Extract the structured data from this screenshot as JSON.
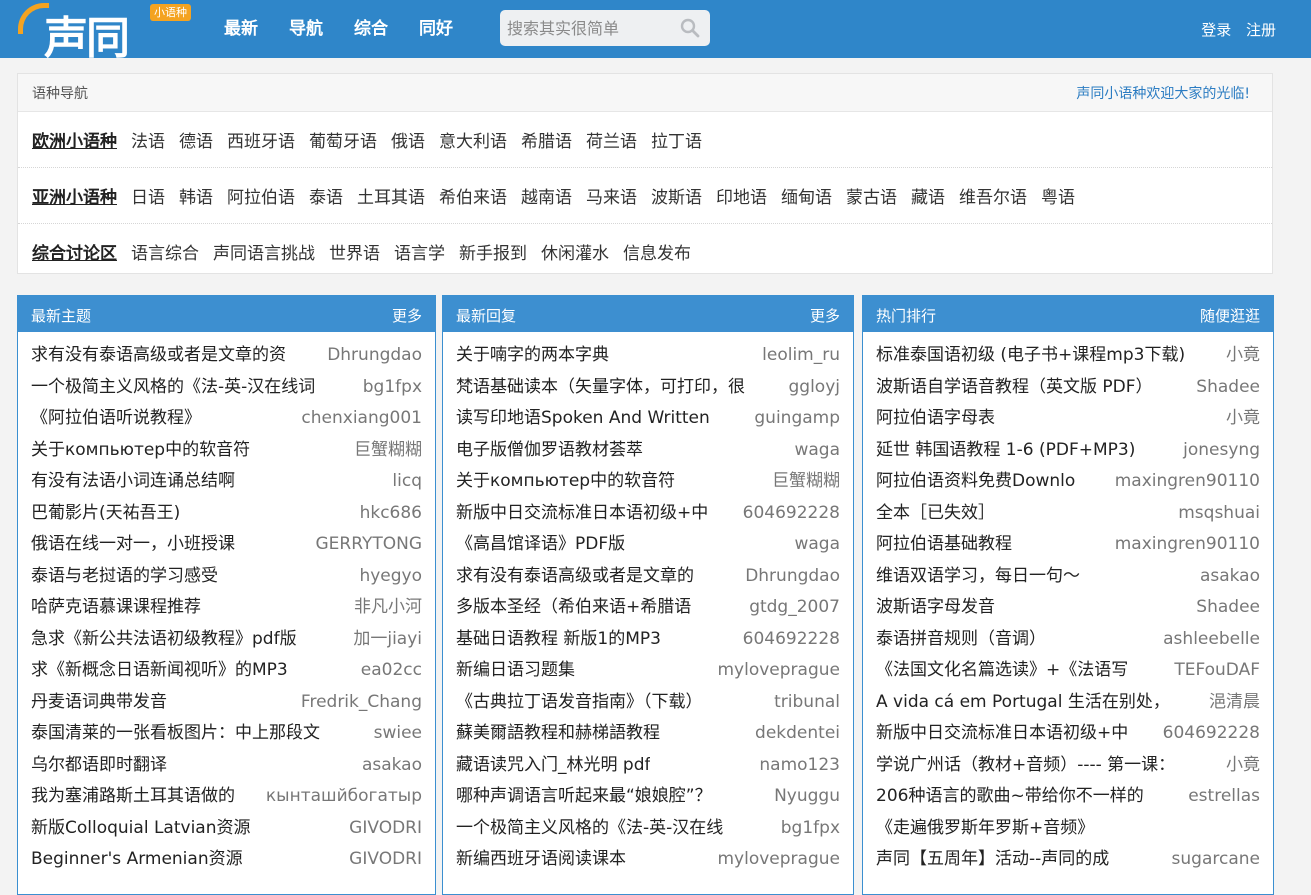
{
  "header": {
    "logo_text": "声同",
    "logo_badge": "小语种",
    "nav": [
      "最新",
      "导航",
      "综合",
      "同好"
    ],
    "search_placeholder": "搜索其实很简单",
    "login": "登录",
    "register": "注册",
    "colors": {
      "bar": "#2f86c9",
      "accent": "#f4a321"
    }
  },
  "langnav": {
    "title": "语种导航",
    "welcome": "声同小语种欢迎大家的光临!",
    "rows": [
      {
        "category": "欧洲小语种",
        "items": [
          "法语",
          "德语",
          "西班牙语",
          "葡萄牙语",
          "俄语",
          "意大利语",
          "希腊语",
          "荷兰语",
          "拉丁语"
        ]
      },
      {
        "category": "亚洲小语种",
        "items": [
          "日语",
          "韩语",
          "阿拉伯语",
          "泰语",
          "土耳其语",
          "希伯来语",
          "越南语",
          "马来语",
          "波斯语",
          "印地语",
          "缅甸语",
          "蒙古语",
          "藏语",
          "维吾尔语",
          "粤语"
        ]
      },
      {
        "category": "综合讨论区",
        "items": [
          "语言综合",
          "声同语言挑战",
          "世界语",
          "语言学",
          "新手报到",
          "休闲灌水",
          "信息发布"
        ]
      }
    ]
  },
  "panels": [
    {
      "title": "最新主题",
      "more": "更多",
      "items": [
        {
          "title": "求有没有泰语高级或者是文章的资",
          "author": "Dhrungdao"
        },
        {
          "title": "一个极简主义风格的《法-英-汉在线词",
          "author": "bg1fpx"
        },
        {
          "title": "《阿拉伯语听说教程》",
          "author": "chenxiang001"
        },
        {
          "title": "关于компьютер中的软音符",
          "author": "巨蟹糊糊"
        },
        {
          "title": "有没有法语小词连诵总结啊",
          "author": "licq"
        },
        {
          "title": "巴葡影片(天祐吾王)",
          "author": "hkc686"
        },
        {
          "title": "俄语在线一对一，小班授课",
          "author": "GERRYTONG"
        },
        {
          "title": "泰语与老挝语的学习感受",
          "author": "hyegyo"
        },
        {
          "title": "哈萨克语慕课课程推荐",
          "author": "非凡小河"
        },
        {
          "title": "急求《新公共法语初级教程》pdf版",
          "author": "加一jiayi"
        },
        {
          "title": "求《新概念日语新闻视听》的MP3",
          "author": "ea02cc"
        },
        {
          "title": "丹麦语词典带发音",
          "author": "Fredrik_Chang"
        },
        {
          "title": "泰国清莱的一张看板图片：中上那段文",
          "author": "swiee"
        },
        {
          "title": "乌尔都语即时翻译",
          "author": "asakao"
        },
        {
          "title": "我为塞浦路斯土耳其语做的",
          "author": "кынташйбогатыр"
        },
        {
          "title": "新版Colloquial Latvian资源",
          "author": "GIVODRI"
        },
        {
          "title": "Beginner's Armenian资源",
          "author": "GIVODRI"
        }
      ]
    },
    {
      "title": "最新回复",
      "more": "更多",
      "items": [
        {
          "title": "关于喃字的两本字典",
          "author": "leolim_ru"
        },
        {
          "title": "梵语基础读本（矢量字体，可打印，很",
          "author": "ggloyj"
        },
        {
          "title": "读写印地语Spoken And Written",
          "author": "guingamp"
        },
        {
          "title": "电子版僧伽罗语教材荟萃",
          "author": "waga"
        },
        {
          "title": "关于компьютер中的软音符",
          "author": "巨蟹糊糊"
        },
        {
          "title": "新版中日交流标准日本语初级+中",
          "author": "604692228"
        },
        {
          "title": "《高昌馆译语》PDF版",
          "author": "waga"
        },
        {
          "title": "求有没有泰语高级或者是文章的",
          "author": "Dhrungdao"
        },
        {
          "title": "多版本圣经（希伯来语+希腊语",
          "author": "gtdg_2007"
        },
        {
          "title": "基础日语教程 新版1的MP3",
          "author": "604692228"
        },
        {
          "title": "新编日语习题集",
          "author": "myloveprague"
        },
        {
          "title": "《古典拉丁语发音指南》（下载）",
          "author": "tribunal"
        },
        {
          "title": "蘇美爾語教程和赫梯語教程",
          "author": "dekdentei"
        },
        {
          "title": "藏语读咒入门_林光明 pdf",
          "author": "namo123"
        },
        {
          "title": "哪种声调语言听起来最“娘娘腔”？",
          "author": "Nyuggu"
        },
        {
          "title": "一个极简主义风格的《法-英-汉在线",
          "author": "bg1fpx"
        },
        {
          "title": "新编西班牙语阅读课本",
          "author": "myloveprague"
        }
      ]
    },
    {
      "title": "热门排行",
      "more": "随便逛逛",
      "items": [
        {
          "title": "标准泰国语初级 (电子书+课程mp3下载)",
          "author": "小竟"
        },
        {
          "title": "波斯语自学语音教程（英文版 PDF）",
          "author": "Shadee"
        },
        {
          "title": "阿拉伯语字母表",
          "author": "小竟"
        },
        {
          "title": "延世 韩国语教程 1-6 (PDF+MP3)",
          "author": "jonesyng"
        },
        {
          "title": "阿拉伯语资料免费Downlo",
          "author": "maxingren90110"
        },
        {
          "title": "全本［已失效］",
          "author": "msqshuai"
        },
        {
          "title": "阿拉伯语基础教程",
          "author": "maxingren90110"
        },
        {
          "title": "维语双语学习，每日一句～",
          "author": "asakao"
        },
        {
          "title": "波斯语字母发音",
          "author": "Shadee"
        },
        {
          "title": "泰语拼音规则（音调）",
          "author": "ashleebelle"
        },
        {
          "title": "《法国文化名篇选读》+《法语写",
          "author": "TEFouDAF"
        },
        {
          "title": "A vida cá em Portugal 生活在别处，",
          "author": "浥清晨"
        },
        {
          "title": "新版中日交流标准日本语初级+中",
          "author": "604692228"
        },
        {
          "title": "学说广州话（教材+音频）---- 第一课：",
          "author": "小竟"
        },
        {
          "title": "206种语言的歌曲~带给你不一样的",
          "author": "estrellas"
        },
        {
          "title": "《走遍俄罗斯年罗斯+音频》",
          "author": ""
        },
        {
          "title": "声同【五周年】活动--声同的成",
          "author": "sugarcane"
        }
      ]
    }
  ]
}
